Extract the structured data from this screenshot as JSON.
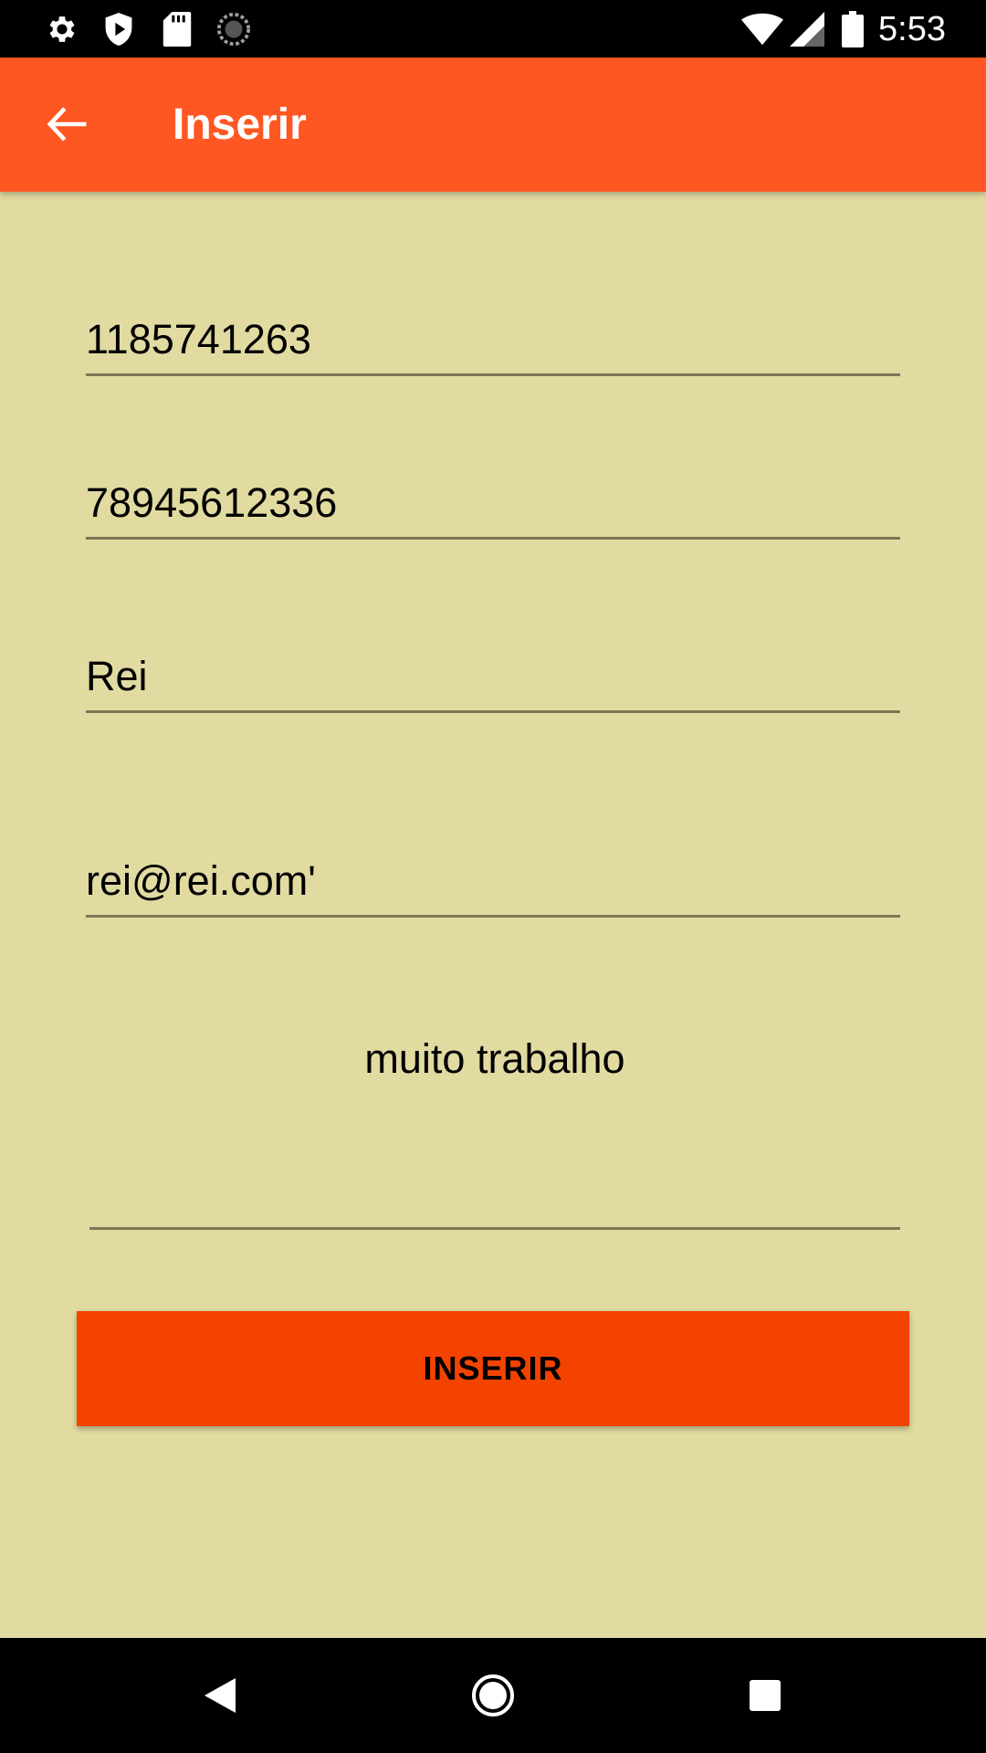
{
  "status_bar": {
    "time": "5:53",
    "left_icons": [
      "settings-icon",
      "shield-play-icon",
      "sd-card-icon",
      "sync-icon"
    ],
    "right_icons": [
      "wifi-icon",
      "signal-icon",
      "battery-icon"
    ]
  },
  "app_bar": {
    "title": "Inserir",
    "back_icon": "arrow-left-icon",
    "background": "#FF5722"
  },
  "form": {
    "phone": {
      "value": "1185741263"
    },
    "cpf": {
      "value": "78945612336"
    },
    "name": {
      "value": "Rei"
    },
    "email": {
      "value": "rei@rei.com'"
    },
    "notes": {
      "value": "muito trabalho"
    }
  },
  "button": {
    "label": "INSERIR",
    "background": "#F44300"
  },
  "nav_bar": {
    "icons": [
      "nav-back-icon",
      "nav-home-icon",
      "nav-recents-icon"
    ]
  },
  "colors": {
    "page_background": "#E1DBA1",
    "underline": "#7C7756"
  }
}
